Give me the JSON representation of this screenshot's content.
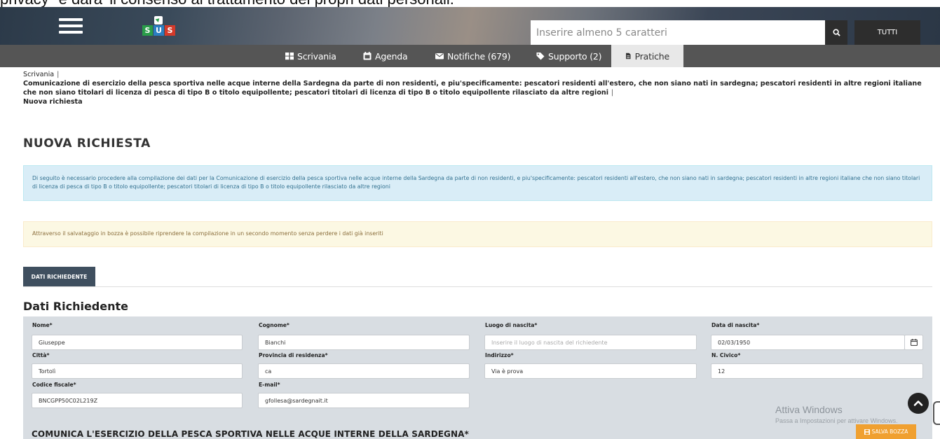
{
  "page_top_text": "privacy\" e dara' il consenso al trattamento dei propri dati personali.",
  "header": {
    "logo_letters": [
      "S",
      "U",
      "S"
    ],
    "search": {
      "placeholder": "Inserire almeno 5 caratteri",
      "value": ""
    },
    "search_button_icon": "search-icon",
    "tutti_label": "TUTTI"
  },
  "nav": {
    "items": [
      {
        "label": "Scrivania",
        "icon": "grid-icon"
      },
      {
        "label": "Agenda",
        "icon": "calendar-icon"
      },
      {
        "label": "Notifiche (679)",
        "icon": "envelope-icon"
      },
      {
        "label": "Supporto (2)",
        "icon": "tag-icon"
      },
      {
        "label": "Pratiche",
        "icon": "document-icon",
        "active": true
      }
    ]
  },
  "breadcrumb": {
    "root": "Scrivania",
    "procedure": "Comunicazione di esercizio della pesca sportiva nelle acque interne della Sardegna da parte di non residenti, e piu'specificamente: pescatori residenti all'estero, che non siano nati in sardegna; pescatori residenti in altre regioni italiane che non siano titolari di licenza di pesca di tipo B o titolo equipollente; pescatori titolari di licenza di tipo B o titolo equipollente rilasciato da altre regioni",
    "current": "Nuova richiesta",
    "separator": "|"
  },
  "page_title": "NUOVA RICHIESTA",
  "alerts": {
    "info": "Di seguito è necessario procedere alla compilazione dei dati per la Comunicazione di esercizio della pesca sportiva nelle acque interne della Sardegna da parte di non residenti, e piu'specificamente: pescatori residenti all'estero, che non siano nati in sardegna; pescatori residenti in altre regioni italiane che non siano titolari di licenza di pesca di tipo B o titolo equipollente; pescatori titolari di licenza di tipo B o titolo equipollente rilasciato da altre regioni",
    "warning": "Attraverso il salvataggio in bozza è possibile riprendere la compilazione in un secondo momento senza perdere i dati già inseriti"
  },
  "tab_label": "DATI RICHIEDENTE",
  "section_title": "Dati Richiedente",
  "form": {
    "nome": {
      "label": "Nome*",
      "value": "Giuseppe"
    },
    "cognome": {
      "label": "Cognome*",
      "value": "Bianchi"
    },
    "luogo_nascita": {
      "label": "Luogo di nascita*",
      "value": "",
      "placeholder": "Inserire il luogo di nascita del richiedente"
    },
    "data_nascita": {
      "label": "Data di nascita*",
      "value": "02/03/1950"
    },
    "citta": {
      "label": "Città*",
      "value": "Tortolì"
    },
    "provincia": {
      "label": "Provincia di residenza*",
      "value": "ca"
    },
    "indirizzo": {
      "label": "Indirizzo*",
      "value": "Via è prova"
    },
    "civico": {
      "label": "N. Civico*",
      "value": "12"
    },
    "codice_fiscale": {
      "label": "Codice fiscale*",
      "value": "BNCGPP50C02L219Z"
    },
    "email": {
      "label": "E-mail*",
      "value": "gfollesa@sardegnait.it"
    }
  },
  "comunica_title": "COMUNICA L'ESERCIZIO DELLA PESCA SPORTIVA NELLE ACQUE INTERNE DELLA SARDEGNA*",
  "windows_watermark": {
    "line1": "Attiva Windows",
    "line2": "Passa a Impostazioni per attivare Windows."
  },
  "salva_bozza_label": "SALVA BOZZA",
  "colors": {
    "nav_bg": "#555555",
    "tab_bg": "#3f4f5f",
    "info_bg": "#d9edf7",
    "warning_bg": "#fcf8e3",
    "form_panel_bg": "#d8dde2",
    "salva_bg": "#f0a030"
  }
}
